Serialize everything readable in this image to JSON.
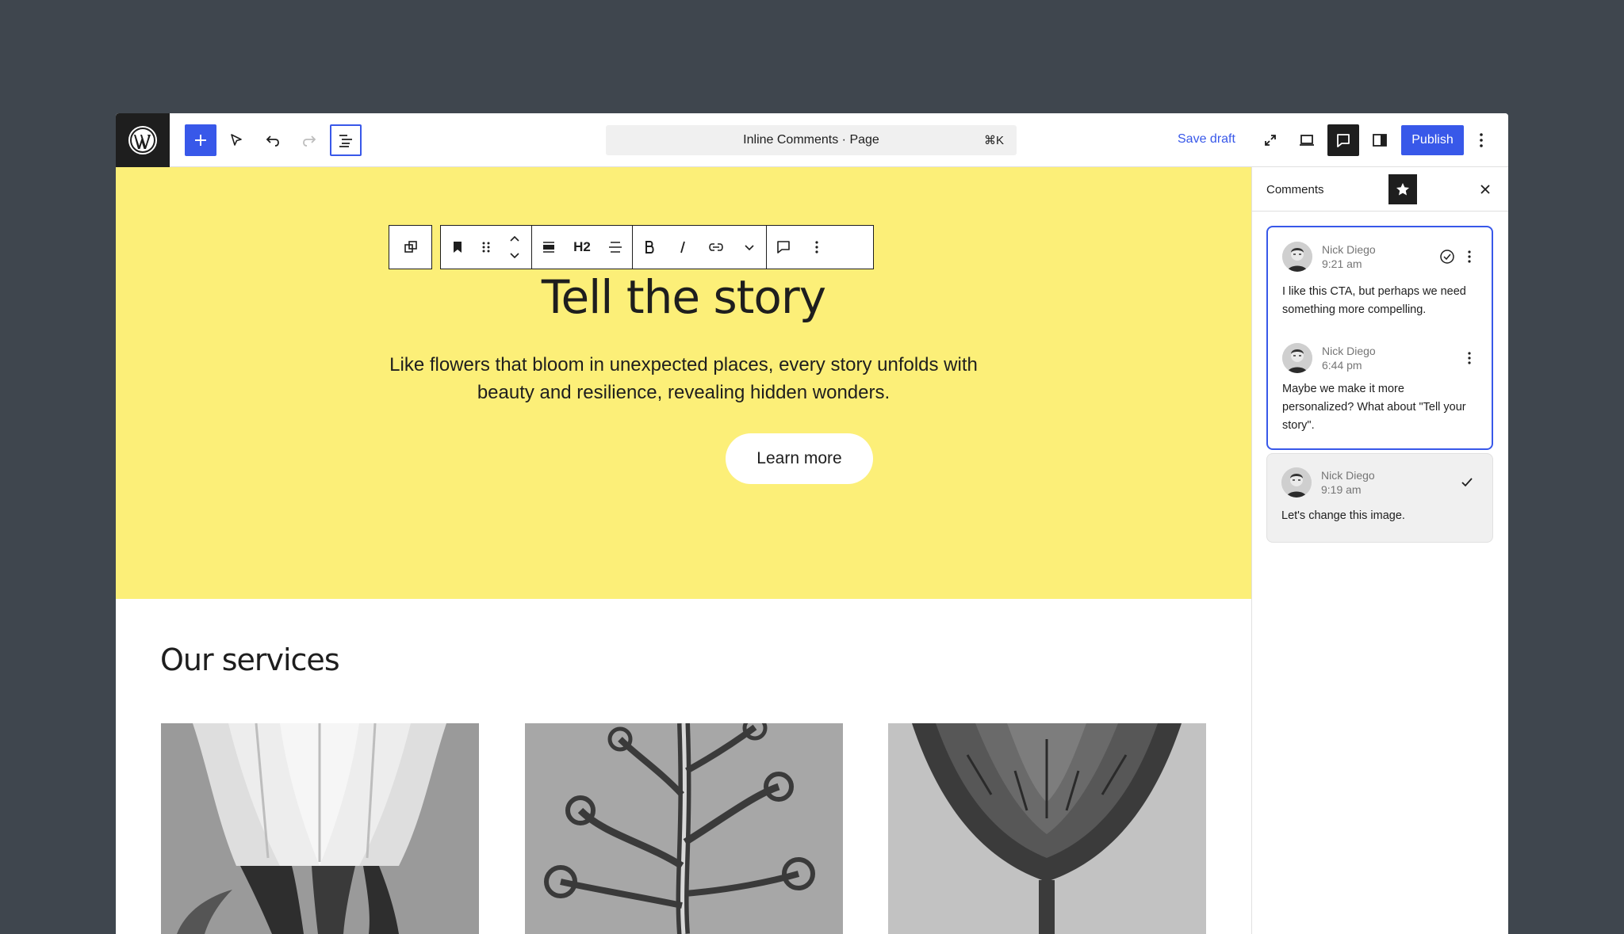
{
  "app": {
    "document_title": "Inline Comments · Page",
    "shortcut": "⌘K",
    "save_draft": "Save draft",
    "publish": "Publish"
  },
  "block_toolbar": {
    "heading_level": "H2"
  },
  "hero": {
    "title": "Tell the story",
    "subtitle": "Like flowers that bloom in unexpected places, every story unfolds with beauty and resilience, revealing hidden wonders.",
    "button": "Learn more"
  },
  "services": {
    "title": "Our services"
  },
  "comments_panel": {
    "title": "Comments",
    "threads": [
      {
        "comments": [
          {
            "author": "Nick Diego",
            "time": "9:21 am",
            "text": "I like this CTA, but perhaps we need something more compelling."
          },
          {
            "author": "Nick Diego",
            "time": "6:44 pm",
            "text": "Maybe we make it more personalized? What about \"Tell your story\"."
          }
        ]
      },
      {
        "resolved": true,
        "comments": [
          {
            "author": "Nick Diego",
            "time": "9:19 am",
            "text": "Let's change this image."
          }
        ]
      }
    ]
  },
  "colors": {
    "accent": "#3858e9",
    "hero_background": "#fcef78",
    "page_background": "#3f464e",
    "dark": "#1e1e1e"
  }
}
